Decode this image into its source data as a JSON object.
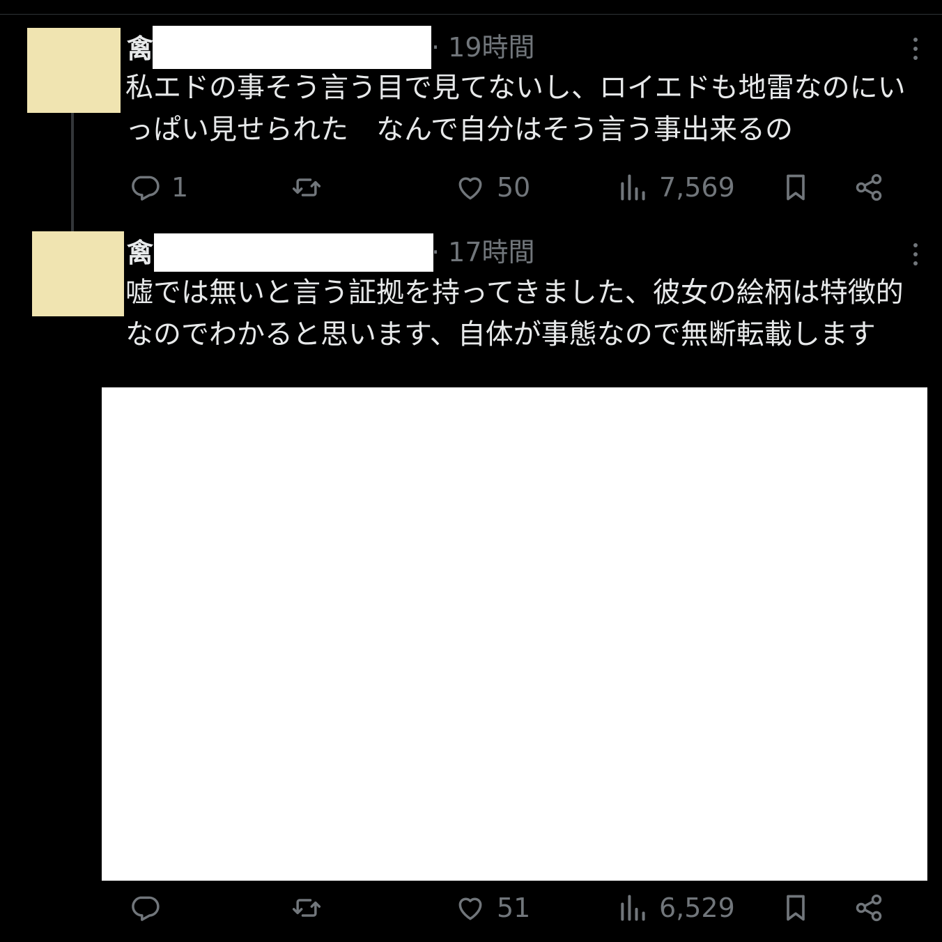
{
  "posts": [
    {
      "name_visible": "禽",
      "time": "· 19時間",
      "text": "私エドの事そう言う目で見てないし、ロイエドも地雷なのにいっぱい見せられた　なんで自分はそう言う事出来るの",
      "replies": "1",
      "reposts": "",
      "likes": "50",
      "views": "7,569"
    },
    {
      "name_visible": "禽",
      "time": "· 17時間",
      "text": "嘘では無いと言う証拠を持ってきました、彼女の絵柄は特徴的なのでわかると思います、自体が事態なので無断転載します",
      "replies": "",
      "reposts": "",
      "likes": "51",
      "views": "6,529"
    }
  ],
  "colors": {
    "background": "#000000",
    "text": "#e7e9ea",
    "muted": "#71767b",
    "avatar_placeholder": "#f0e4b1"
  },
  "icons": [
    "reply-icon",
    "repost-icon",
    "like-icon",
    "views-icon",
    "bookmark-icon",
    "share-icon",
    "more-icon"
  ]
}
